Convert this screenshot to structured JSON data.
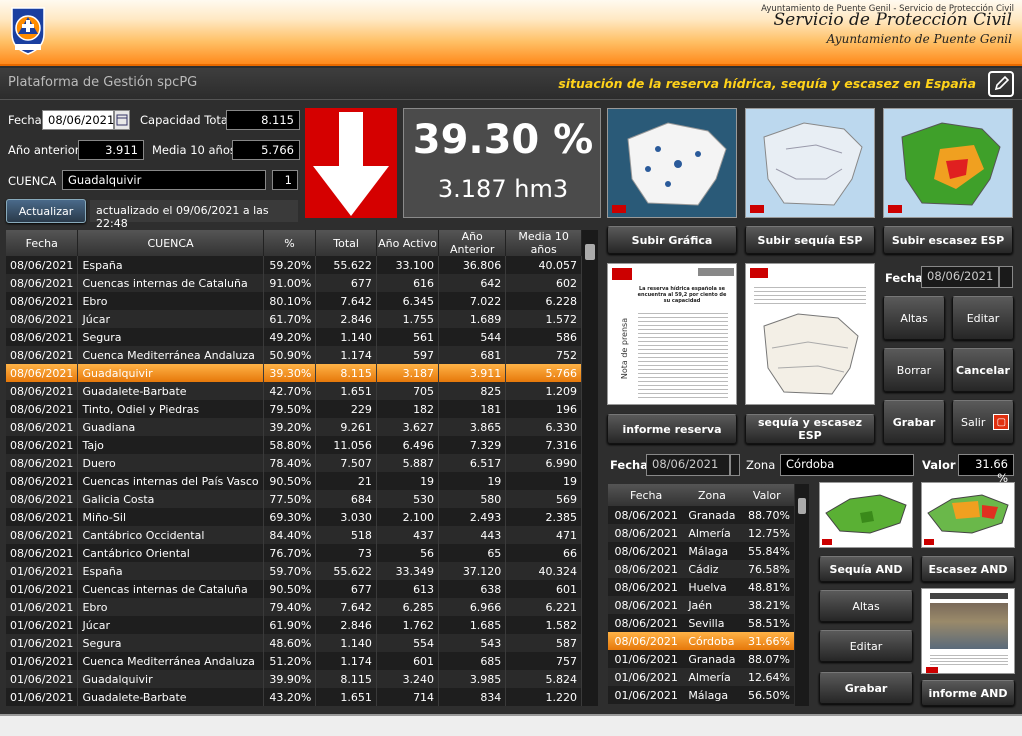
{
  "header": {
    "title": "Servicio de Protección Civil",
    "subtitle": "Ayuntamiento de Puente Genil",
    "logo_text": "PROTECCIÓN CIVIL · Puente Genil"
  },
  "subbar": {
    "platform": "Plataforma de Gestión spcPG",
    "section_title": "situación de la reserva hídrica, sequía y escasez en España"
  },
  "form": {
    "fecha_label": "Fecha",
    "fecha_value": "08/06/2021",
    "capacidad_label": "Capacidad Total",
    "capacidad_value": "8.115",
    "anio_anterior_label": "Año anterior",
    "anio_anterior_value": "3.911",
    "media_label": "Media 10 años",
    "media_value": "5.766",
    "cuenca_label": "CUENCA",
    "cuenca_value": "Guadalquivir",
    "cuenca_num": "1",
    "actualizar_label": "Actualizar",
    "status": "actualizado el 09/06/2021 a las 22:48"
  },
  "summary": {
    "percent": "39.30 %",
    "volume": "3.187 hm3",
    "trend": "down",
    "trend_color": "#d50000"
  },
  "main_table": {
    "headers": [
      "Fecha",
      "CUENCA",
      "%",
      "Total",
      "Año Activo",
      "Año Anterior",
      "Media 10 años"
    ],
    "selected_row": 6,
    "rows": [
      [
        "08/06/2021",
        "España",
        "59.20%",
        "55.622",
        "33.100",
        "36.806",
        "40.057"
      ],
      [
        "08/06/2021",
        "Cuencas internas de Cataluña",
        "91.00%",
        "677",
        "616",
        "642",
        "602"
      ],
      [
        "08/06/2021",
        "Ebro",
        "80.10%",
        "7.642",
        "6.345",
        "7.022",
        "6.228"
      ],
      [
        "08/06/2021",
        "Júcar",
        "61.70%",
        "2.846",
        "1.755",
        "1.689",
        "1.572"
      ],
      [
        "08/06/2021",
        "Segura",
        "49.20%",
        "1.140",
        "561",
        "544",
        "586"
      ],
      [
        "08/06/2021",
        "Cuenca Mediterránea Andaluza",
        "50.90%",
        "1.174",
        "597",
        "681",
        "752"
      ],
      [
        "08/06/2021",
        "Guadalquivir",
        "39.30%",
        "8.115",
        "3.187",
        "3.911",
        "5.766"
      ],
      [
        "08/06/2021",
        "Guadalete-Barbate",
        "42.70%",
        "1.651",
        "705",
        "825",
        "1.209"
      ],
      [
        "08/06/2021",
        "Tinto, Odiel y Piedras",
        "79.50%",
        "229",
        "182",
        "181",
        "196"
      ],
      [
        "08/06/2021",
        "Guadiana",
        "39.20%",
        "9.261",
        "3.627",
        "3.865",
        "6.330"
      ],
      [
        "08/06/2021",
        "Tajo",
        "58.80%",
        "11.056",
        "6.496",
        "7.329",
        "7.316"
      ],
      [
        "08/06/2021",
        "Duero",
        "78.40%",
        "7.507",
        "5.887",
        "6.517",
        "6.990"
      ],
      [
        "08/06/2021",
        "Cuencas internas del País Vasco",
        "90.50%",
        "21",
        "19",
        "19",
        "19"
      ],
      [
        "08/06/2021",
        "Galicia Costa",
        "77.50%",
        "684",
        "530",
        "580",
        "569"
      ],
      [
        "08/06/2021",
        "Miño-Sil",
        "69.30%",
        "3.030",
        "2.100",
        "2.493",
        "2.385"
      ],
      [
        "08/06/2021",
        "Cantábrico Occidental",
        "84.40%",
        "518",
        "437",
        "443",
        "471"
      ],
      [
        "08/06/2021",
        "Cantábrico Oriental",
        "76.70%",
        "73",
        "56",
        "65",
        "66"
      ],
      [
        "01/06/2021",
        "España",
        "59.70%",
        "55.622",
        "33.349",
        "37.120",
        "40.324"
      ],
      [
        "01/06/2021",
        "Cuencas internas de Cataluña",
        "90.50%",
        "677",
        "613",
        "638",
        "601"
      ],
      [
        "01/06/2021",
        "Ebro",
        "79.40%",
        "7.642",
        "6.285",
        "6.966",
        "6.221"
      ],
      [
        "01/06/2021",
        "Júcar",
        "61.90%",
        "2.846",
        "1.762",
        "1.685",
        "1.582"
      ],
      [
        "01/06/2021",
        "Segura",
        "48.60%",
        "1.140",
        "554",
        "543",
        "587"
      ],
      [
        "01/06/2021",
        "Cuenca Mediterránea Andaluza",
        "51.20%",
        "1.174",
        "601",
        "685",
        "757"
      ],
      [
        "01/06/2021",
        "Guadalquivir",
        "39.90%",
        "8.115",
        "3.240",
        "3.985",
        "5.824"
      ],
      [
        "01/06/2021",
        "Guadalete-Barbate",
        "43.20%",
        "1.651",
        "714",
        "834",
        "1.220"
      ]
    ]
  },
  "right_panel": {
    "btn_subir_grafica": "Subir Gráfica",
    "btn_subir_sequia": "Subir sequía ESP",
    "btn_subir_escasez": "Subir escasez ESP",
    "fecha_label": "Fecha",
    "fecha_value": "08/06/2021",
    "btn_altas": "Altas",
    "btn_editar": "Editar",
    "btn_borrar": "Borrar",
    "btn_cancelar": "Cancelar",
    "btn_grabar": "Grabar",
    "btn_salir": "Salir",
    "btn_informe_reserva": "informe reserva",
    "btn_sequia_escasez": "sequía y escasez ESP",
    "doc_heading": "La reserva hídrica española se encuentra al 59,2 por ciento de su capacidad",
    "doc_side": "Nota de prensa"
  },
  "zone_panel": {
    "fecha_label": "Fecha",
    "fecha_value": "08/06/2021",
    "zona_label": "Zona",
    "zona_value": "Córdoba",
    "valor_label": "Valor",
    "valor_value": "31.66 %",
    "headers": [
      "Fecha",
      "Zona",
      "Valor"
    ],
    "selected_row": 7,
    "rows": [
      [
        "08/06/2021",
        "Granada",
        "88.70%"
      ],
      [
        "08/06/2021",
        "Almería",
        "12.75%"
      ],
      [
        "08/06/2021",
        "Málaga",
        "55.84%"
      ],
      [
        "08/06/2021",
        "Cádiz",
        "76.58%"
      ],
      [
        "08/06/2021",
        "Huelva",
        "48.81%"
      ],
      [
        "08/06/2021",
        "Jaén",
        "38.21%"
      ],
      [
        "08/06/2021",
        "Sevilla",
        "58.51%"
      ],
      [
        "08/06/2021",
        "Córdoba",
        "31.66%"
      ],
      [
        "01/06/2021",
        "Granada",
        "88.07%"
      ],
      [
        "01/06/2021",
        "Almería",
        "12.64%"
      ],
      [
        "01/06/2021",
        "Málaga",
        "56.50%"
      ]
    ],
    "btn_sequia_and": "Sequía AND",
    "btn_escasez_and": "Escasez AND",
    "btn_altas": "Altas",
    "btn_editar": "Editar",
    "btn_grabar": "Grabar",
    "btn_informe_and": "informe AND"
  },
  "footer": {
    "text": "Ayuntamiento de Puente Genil - Servicio de Protección Civil"
  }
}
